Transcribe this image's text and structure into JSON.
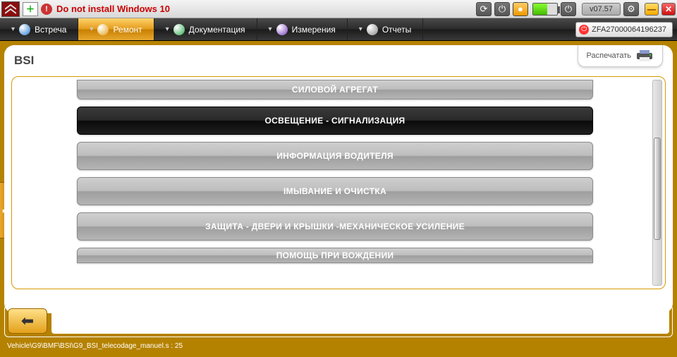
{
  "titlebar": {
    "warning_text": "Do not install Windows 10",
    "version": "v07.57"
  },
  "tabs": [
    {
      "label": "Встреча",
      "icon_color": "#2a7bd4",
      "active": false
    },
    {
      "label": "Ремонт",
      "icon_color": "#e3a01a",
      "active": true
    },
    {
      "label": "Документация",
      "icon_color": "#2aa84a",
      "active": false
    },
    {
      "label": "Измерения",
      "icon_color": "#7a3fbf",
      "active": false
    },
    {
      "label": "Отчеты",
      "icon_color": "#888888",
      "active": false
    }
  ],
  "vin": "ZFA27000064196237",
  "page_title": "BSI",
  "print_label": "Распечатать",
  "menu_items": [
    {
      "label": "СИЛОВОЙ АГРЕГАТ",
      "selected": false,
      "cut": "top"
    },
    {
      "label": "ОСВЕЩЕНИЕ - СИГНАЛИЗАЦИЯ",
      "selected": true
    },
    {
      "label": "ИНФОРМАЦИЯ ВОДИТЕЛЯ",
      "selected": false
    },
    {
      "label": "IМЫВАНИЕ И ОЧИСТКА",
      "selected": false
    },
    {
      "label": "ЗАЩИТА - ДВЕРИ И КРЫШКИ -МЕХАНИЧЕСКОЕ УСИЛЕНИЕ",
      "selected": false
    },
    {
      "label": "ПОМОЩЬ ПРИ ВОЖДЕНИИ",
      "selected": false,
      "cut": "bottom"
    }
  ],
  "status_text": "Vehicle\\G9\\BMF\\BSI\\G9_BSI_telecodage_manuel.s : 25"
}
